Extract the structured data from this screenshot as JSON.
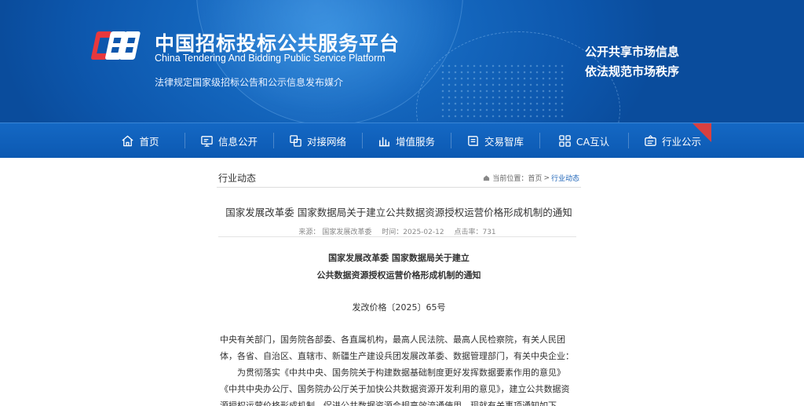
{
  "header": {
    "brand_cn": "中国招标投标公共服务平台",
    "brand_en": "China Tendering And Bidding Public Service Platform",
    "brand_sub": "法律规定国家级招标公告和公示信息发布媒介",
    "slogan_line1": "公开共享市场信息",
    "slogan_line2": "依法规范市场秩序",
    "logo_icon": "cebpub-logo-icon"
  },
  "nav": {
    "items": [
      {
        "label": "首页",
        "icon": "home-icon"
      },
      {
        "label": "信息公开",
        "icon": "monitor-icon"
      },
      {
        "label": "对接网络",
        "icon": "network-icon"
      },
      {
        "label": "增值服务",
        "icon": "bar-chart-icon"
      },
      {
        "label": "交易智库",
        "icon": "book-icon"
      },
      {
        "label": "CA互认",
        "icon": "grid-icon"
      },
      {
        "label": "行业公示",
        "icon": "announcement-icon"
      }
    ]
  },
  "page": {
    "section_title": "行业动态",
    "breadcrumb": {
      "prefix": "当前位置：",
      "home": "首页",
      "separator": ">",
      "current": "行业动态"
    }
  },
  "article": {
    "title": "国家发展改革委 国家数据局关于建立公共数据资源授权运营价格形成机制的通知",
    "meta": {
      "source_label": "来源：",
      "source": "国家发展改革委",
      "time_label": "时间：",
      "time": "2025-02-12",
      "clicks_label": "点击率：",
      "clicks": "731"
    },
    "doc_head_line1": "国家发展改革委 国家数据局关于建立",
    "doc_head_line2": "公共数据资源授权运营价格形成机制的通知",
    "doc_number": "发改价格〔2025〕65号",
    "para1": "中央有关部门，国务院各部委、各直属机构，最高人民法院、最高人民检察院，有关人民团体，各省、自治区、直辖市、新疆生产建设兵团发展改革委、数据管理部门，有关中央企业：",
    "para2": "为贯彻落实《中共中央、国务院关于构建数据基础制度更好发挥数据要素作用的意见》《中共中央办公厅、国务院办公厅关于加快公共数据资源开发利用的意见》，建立公共数据资源授权运营价格形成机制，促进公共数据资源合规高效流通使用，现就有关事项通知如下。"
  },
  "colors": {
    "banner": "#0d57ad",
    "nav": "#1063bd",
    "link": "#1a62b7",
    "corner_badge": "#d94040"
  }
}
